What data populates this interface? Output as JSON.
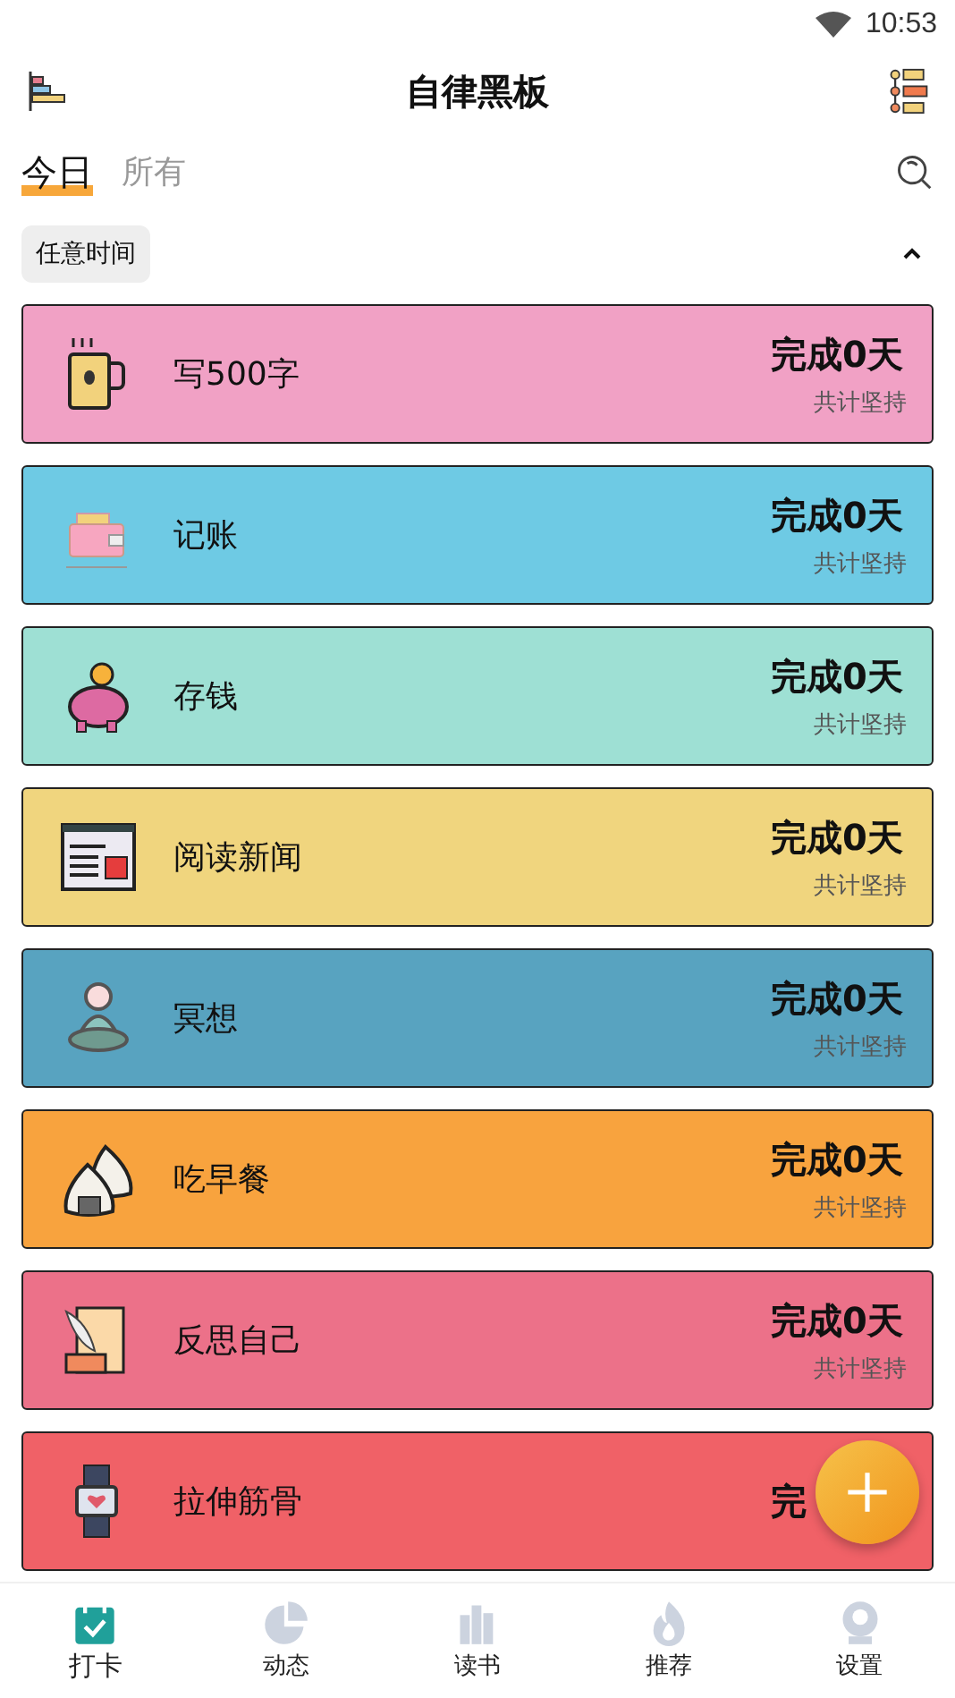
{
  "status_bar": {
    "time": "10:53"
  },
  "header": {
    "title": "自律黑板"
  },
  "tabs": [
    {
      "label": "今日",
      "selected": true
    },
    {
      "label": "所有",
      "selected": false
    }
  ],
  "filter": {
    "label": "任意时间",
    "expanded": true
  },
  "habits": [
    {
      "name": "写500字",
      "status": "完成0天",
      "note": "共计坚持",
      "color": "#f1a1c5"
    },
    {
      "name": "记账",
      "status": "完成0天",
      "note": "共计坚持",
      "color": "#6ecae4"
    },
    {
      "name": "存钱",
      "status": "完成0天",
      "note": "共计坚持",
      "color": "#9ee0d4"
    },
    {
      "name": "阅读新闻",
      "status": "完成0天",
      "note": "共计坚持",
      "color": "#f0d57e"
    },
    {
      "name": "冥想",
      "status": "完成0天",
      "note": "共计坚持",
      "color": "#58a3c0"
    },
    {
      "name": "吃早餐",
      "status": "完成0天",
      "note": "共计坚持",
      "color": "#f8a33e"
    },
    {
      "name": "反思自己",
      "status": "完成0天",
      "note": "共计坚持",
      "color": "#ec7189"
    },
    {
      "name": "拉伸筋骨",
      "status": "完",
      "color": "#f06167"
    }
  ],
  "nav": [
    {
      "label": "打卡",
      "selected": true
    },
    {
      "label": "动态",
      "selected": false
    },
    {
      "label": "读书",
      "selected": false
    },
    {
      "label": "推荐",
      "selected": false
    },
    {
      "label": "设置",
      "selected": false
    }
  ]
}
